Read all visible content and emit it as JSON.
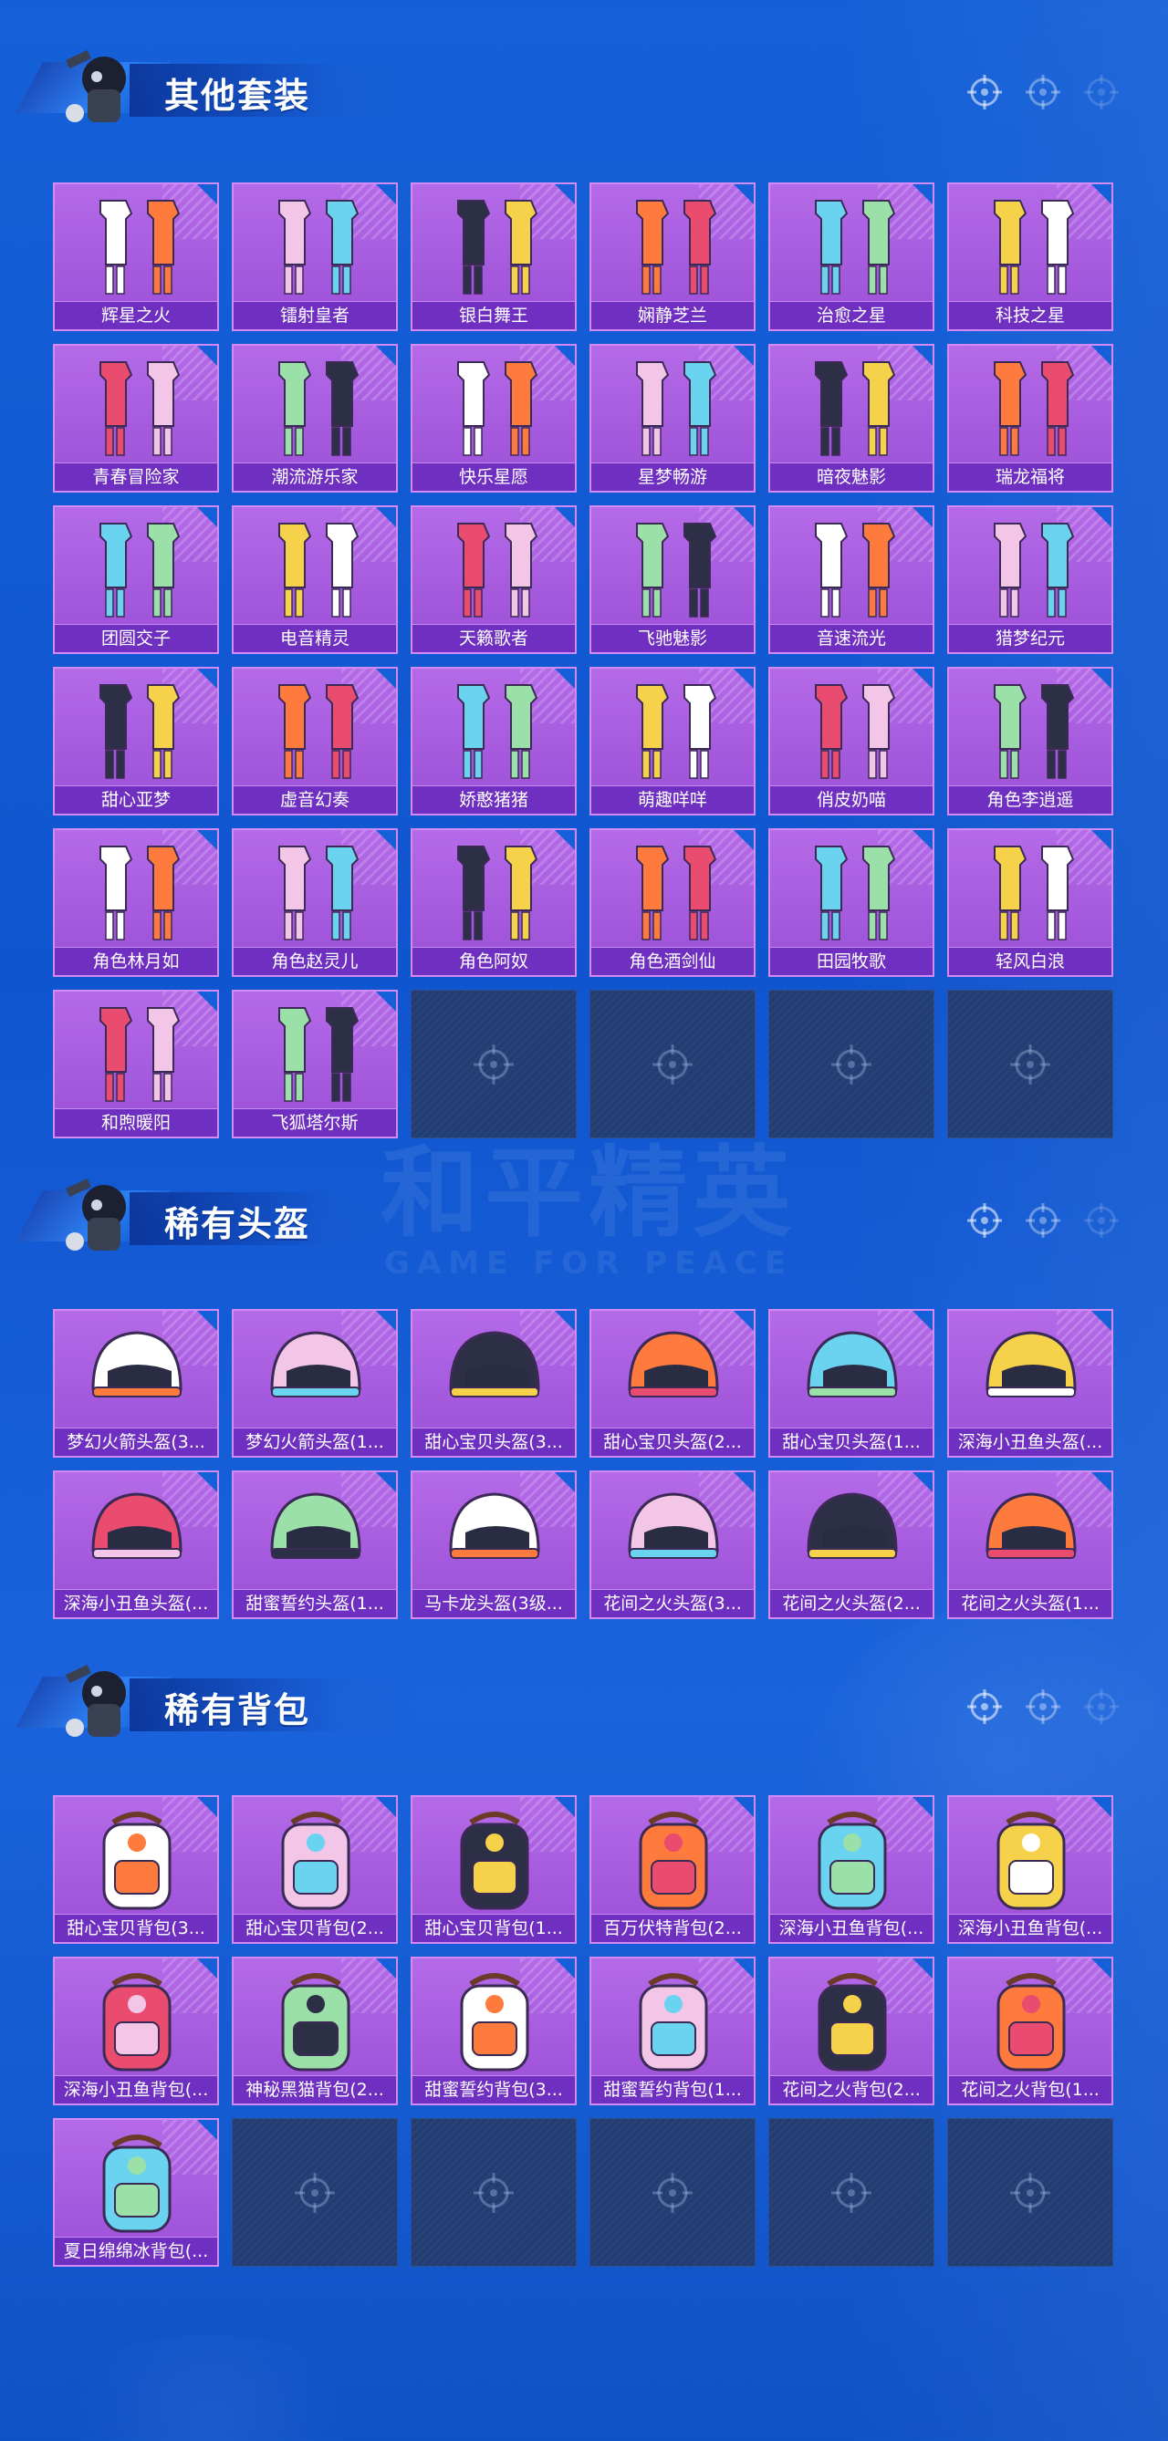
{
  "watermark": {
    "main": "和平精英",
    "sub": "GAME FOR PEACE"
  },
  "sections": [
    {
      "title": "其他套装",
      "kind": "outfit",
      "items": [
        "辉星之火",
        "镭射皇者",
        "银白舞王",
        "娴静芝兰",
        "治愈之星",
        "科技之星",
        "青春冒险家",
        "潮流游乐家",
        "快乐星愿",
        "星梦畅游",
        "暗夜魅影",
        "瑞龙福将",
        "团圆交子",
        "电音精灵",
        "天籁歌者",
        "飞驰魅影",
        "音速流光",
        "猎梦纪元",
        "甜心亚梦",
        "虚音幻奏",
        "娇憨猪猪",
        "萌趣咩咩",
        "俏皮奶喵",
        "角色李逍遥",
        "角色林月如",
        "角色赵灵儿",
        "角色阿奴",
        "角色酒剑仙",
        "田园牧歌",
        "轻风白浪",
        "和煦暖阳",
        "飞狐塔尔斯"
      ],
      "empty_slots": 4
    },
    {
      "title": "稀有头盔",
      "kind": "helmet",
      "items": [
        "梦幻火箭头盔(3...",
        "梦幻火箭头盔(1...",
        "甜心宝贝头盔(3...",
        "甜心宝贝头盔(2...",
        "甜心宝贝头盔(1...",
        "深海小丑鱼头盔(...",
        "深海小丑鱼头盔(...",
        "甜蜜誓约头盔(1...",
        "马卡龙头盔(3级...",
        "花间之火头盔(3...",
        "花间之火头盔(2...",
        "花间之火头盔(1..."
      ],
      "empty_slots": 0
    },
    {
      "title": "稀有背包",
      "kind": "backpack",
      "items": [
        "甜心宝贝背包(3...",
        "甜心宝贝背包(2...",
        "甜心宝贝背包(1...",
        "百万伏特背包(2...",
        "深海小丑鱼背包(...",
        "深海小丑鱼背包(...",
        "深海小丑鱼背包(...",
        "神秘黑猫背包(2...",
        "甜蜜誓约背包(3...",
        "甜蜜誓约背包(1...",
        "花间之火背包(2...",
        "花间之火背包(1...",
        "夏日绵绵冰背包(..."
      ],
      "empty_slots": 5
    }
  ],
  "icons": {
    "section_marker": "crosshair-icon",
    "empty_slot": "crosshair-icon"
  },
  "colors": {
    "background": "#1560d8",
    "card": "#b56ae8",
    "label_bar": "#6f2fc0",
    "empty_slot": "#223d73"
  }
}
